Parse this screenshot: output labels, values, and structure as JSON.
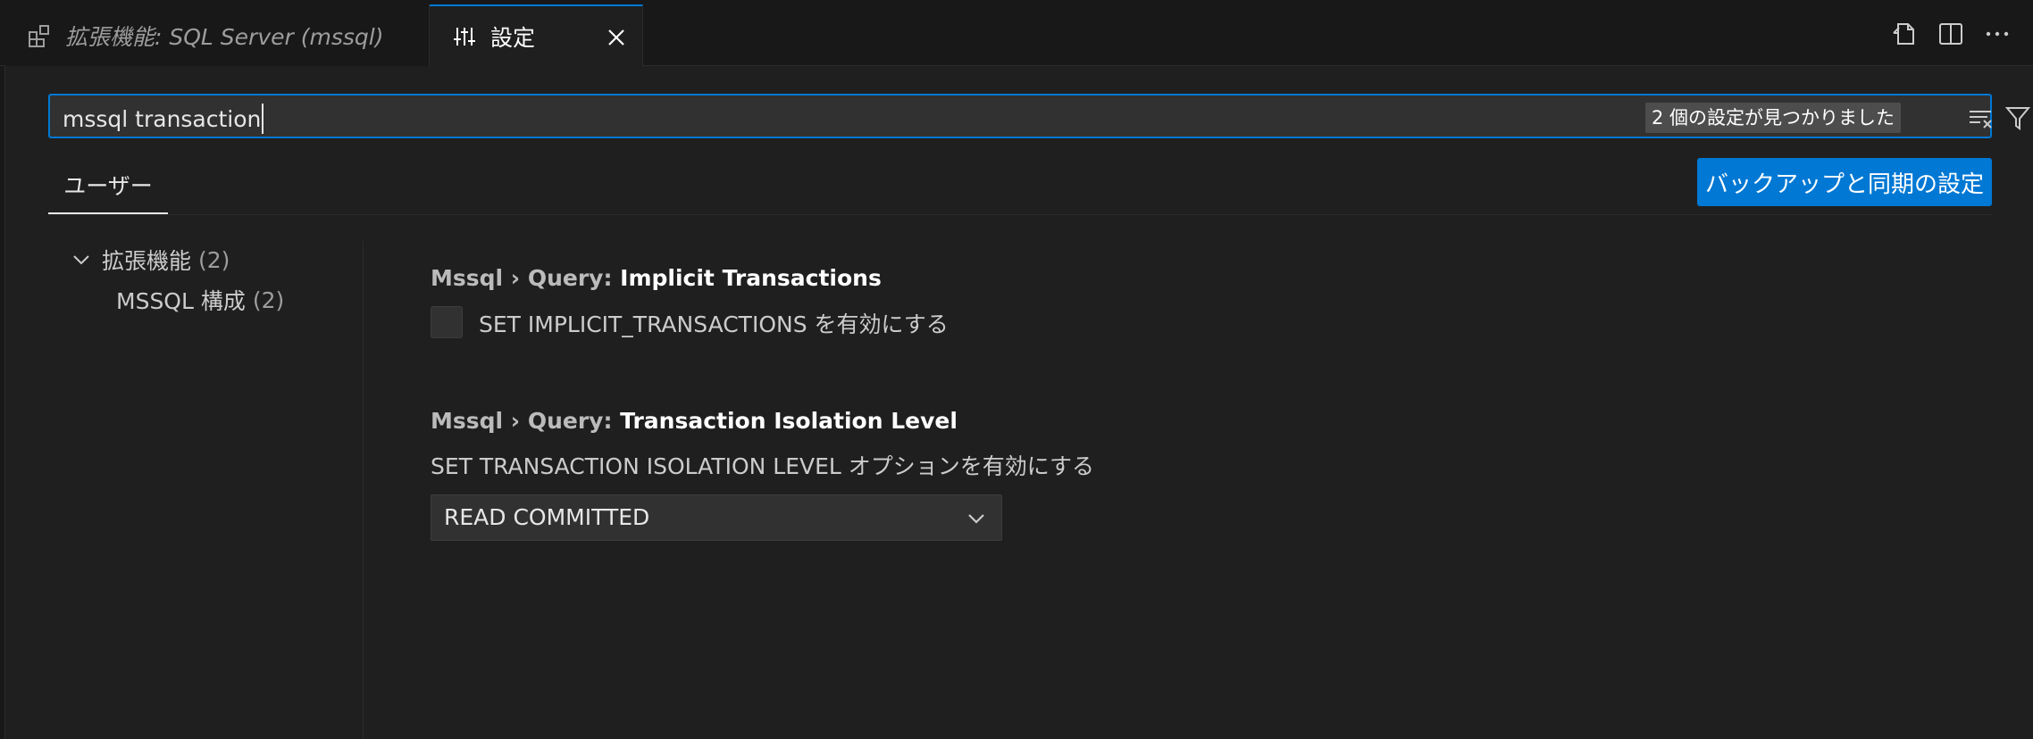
{
  "tabs": [
    {
      "label": "拡張機能: SQL Server (mssql)",
      "icon": "extensions-icon",
      "active": false
    },
    {
      "label": "設定",
      "icon": "settings-sliders-icon",
      "active": true
    }
  ],
  "editor_actions": [
    "open-settings-json-icon",
    "split-editor-icon",
    "more-actions-icon"
  ],
  "search": {
    "value": "mssql transaction",
    "result_count": "2 個の設定が見つかりました"
  },
  "scope": {
    "tab": "ユーザー",
    "sync_button": "バックアップと同期の設定"
  },
  "tree": {
    "group_label": "拡張機能",
    "group_count": "(2)",
    "child_label": "MSSQL 構成",
    "child_count": "(2)"
  },
  "settings": [
    {
      "category": "Mssql › Query: ",
      "name": "Implicit Transactions",
      "checkbox_label": "SET IMPLICIT_TRANSACTIONS を有効にする",
      "checked": false
    },
    {
      "category": "Mssql › Query: ",
      "name": "Transaction Isolation Level",
      "description": "SET TRANSACTION ISOLATION LEVEL オプションを有効にする",
      "value": "READ COMMITTED"
    }
  ],
  "colors": {
    "accent": "#0078d4",
    "background": "#1f1f1f",
    "tabbar": "#181818"
  }
}
